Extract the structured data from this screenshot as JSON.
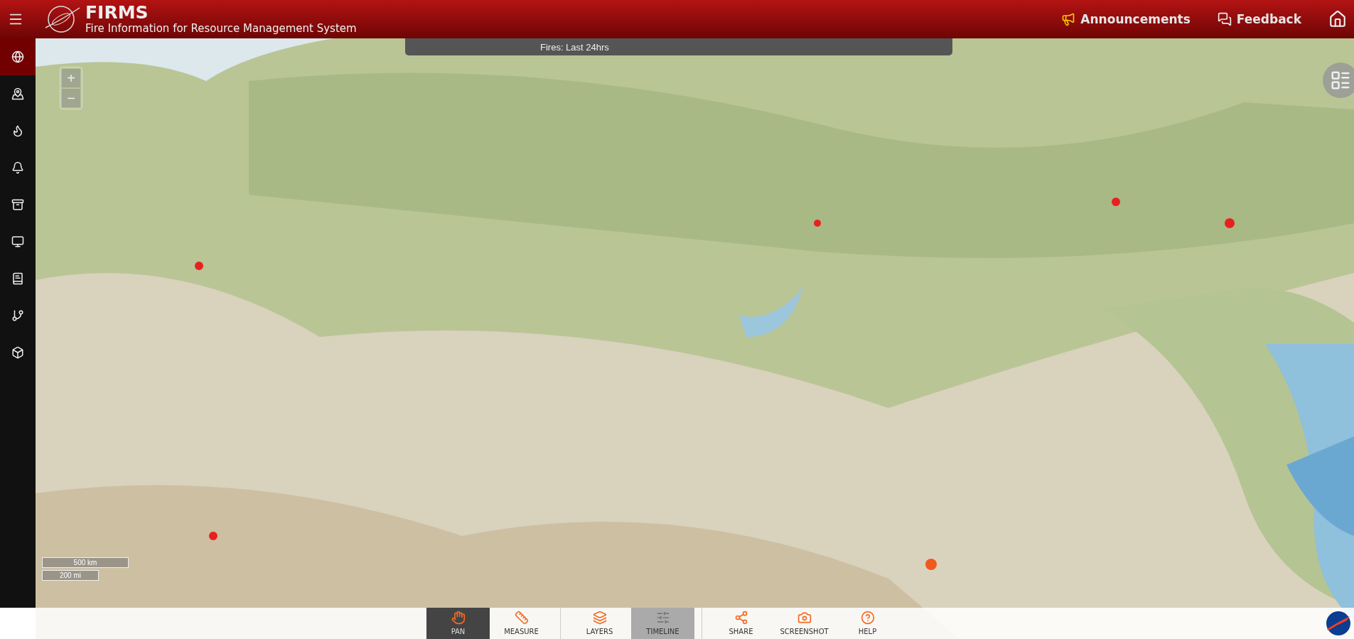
{
  "header": {
    "title": "FIRMS",
    "subtitle": "Fire Information for Resource Management System",
    "links": [
      {
        "label": "Announcements"
      },
      {
        "label": "Feedback"
      }
    ]
  },
  "sidebar": {
    "items": [
      {
        "selected": true
      },
      {
        "selected": false
      },
      {
        "selected": false
      },
      {
        "selected": false
      },
      {
        "selected": false
      },
      {
        "selected": false
      },
      {
        "selected": false
      },
      {
        "selected": false
      },
      {
        "selected": false
      }
    ]
  },
  "map": {
    "kind": "picture",
    "banner": "Fires: Last 24hrs",
    "zoom_in": "+",
    "zoom_out": "−",
    "scale": [
      "500 km",
      "200 mi"
    ]
  },
  "toolbar": {
    "items": [
      {
        "label": "PAN",
        "selected": true,
        "disabled": false,
        "divider_before": false
      },
      {
        "label": "MEASURE",
        "selected": false,
        "disabled": false,
        "divider_before": false
      },
      {
        "label": "LAYERS",
        "selected": false,
        "disabled": false,
        "divider_before": true
      },
      {
        "label": "TIMELINE",
        "selected": false,
        "disabled": true,
        "divider_before": false
      },
      {
        "label": "SHARE",
        "selected": false,
        "disabled": false,
        "divider_before": true
      },
      {
        "label": "SCREENSHOT",
        "selected": false,
        "disabled": false,
        "divider_before": false
      },
      {
        "label": "HELP",
        "selected": false,
        "disabled": false,
        "divider_before": false
      }
    ]
  }
}
